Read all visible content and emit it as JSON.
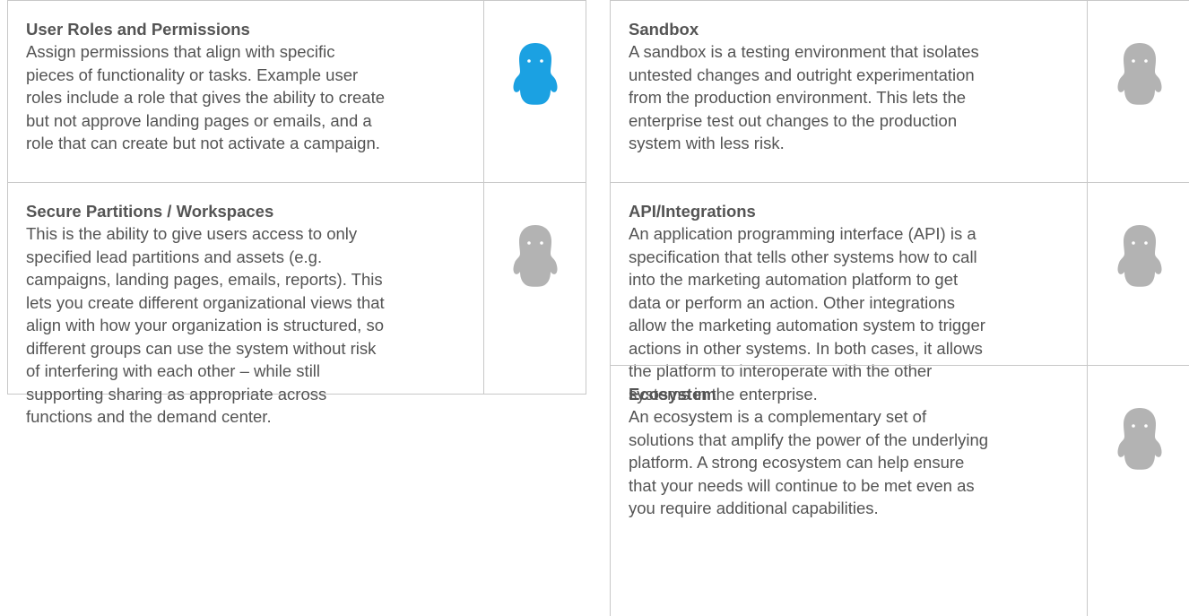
{
  "colors": {
    "active_icon": "#1ba1e2",
    "inactive_icon": "#b3b3b3",
    "text": "#545454",
    "border": "#c8c8c8"
  },
  "left_column": {
    "rows": [
      {
        "title": "User Roles and Permissions",
        "body": "Assign permissions that align with specific\npieces of functionality or tasks.  Example user\nroles include a role that gives the ability to create\nbut not approve landing pages or emails, and a\nrole that can create but not activate a campaign.",
        "icon": "mascot-icon-active"
      },
      {
        "title": "Secure Partitions / Workspaces",
        "body": "This is the ability to give users access to only\nspecified lead partitions and assets (e.g.\ncampaigns, landing pages, emails, reports). This\nlets you create different organizational views that\nalign with how your organization is structured, so\ndifferent groups can use the system without risk\nof interfering with each other – while still\nsupporting sharing as appropriate across\nfunctions and the demand center.",
        "icon": "mascot-icon-inactive"
      }
    ]
  },
  "right_column": {
    "rows": [
      {
        "title": "Sandbox",
        "body": "A sandbox is a testing environment that isolates\nuntested changes and outright experimentation\nfrom the production environment. This lets the\nenterprise test out changes to the production\nsystem with less risk.",
        "icon": "mascot-icon-inactive"
      },
      {
        "title": "API/Integrations",
        "body": "An application programming interface (API) is a\nspecification that tells other systems how to call\ninto the marketing automation platform to get\ndata or perform an action. Other integrations\nallow the marketing automation system to trigger\nactions in other systems. In both cases, it allows\nthe platform to interoperate with the other\nsystems in the enterprise.",
        "icon": "mascot-icon-inactive"
      },
      {
        "title": "Ecosystem",
        "body": "An ecosystem is a complementary set of\nsolutions that amplify the power of the underlying\nplatform. A strong ecosystem can help ensure\nthat your needs will continue to be met even as\nyou require additional capabilities.",
        "icon": "mascot-icon-inactive"
      }
    ]
  }
}
